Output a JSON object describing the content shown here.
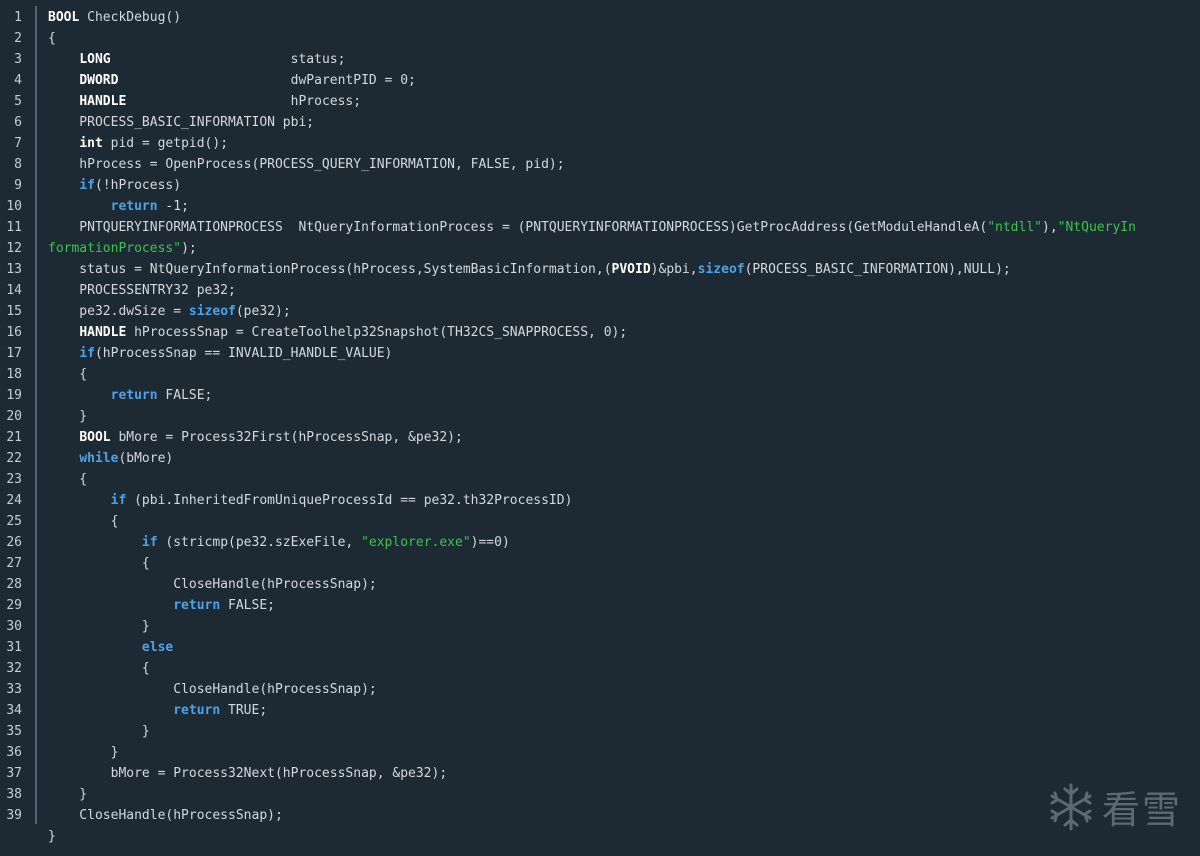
{
  "editor": {
    "language": "c",
    "token_colors": {
      "background": "#1e2a33",
      "plain": "#d2d8dd",
      "keyword": "#4aa3ea",
      "type": "#ffffff",
      "string": "#36c64b",
      "line_number": "#c6cdd2"
    },
    "lines": [
      {
        "n": "1",
        "tokens": [
          [
            "ty",
            "BOOL"
          ],
          [
            "p",
            " CheckDebug()"
          ]
        ]
      },
      {
        "n": "2",
        "tokens": [
          [
            "p",
            "{"
          ]
        ]
      },
      {
        "n": "3",
        "tokens": [
          [
            "p",
            "    "
          ],
          [
            "ty",
            "LONG"
          ],
          [
            "p",
            "                       status;"
          ]
        ]
      },
      {
        "n": "4",
        "tokens": [
          [
            "p",
            "    "
          ],
          [
            "ty",
            "DWORD"
          ],
          [
            "p",
            "                      dwParentPID = 0;"
          ]
        ]
      },
      {
        "n": "5",
        "tokens": [
          [
            "p",
            "    "
          ],
          [
            "ty",
            "HANDLE"
          ],
          [
            "p",
            "                     hProcess;"
          ]
        ]
      },
      {
        "n": "6",
        "tokens": [
          [
            "p",
            "    PROCESS_BASIC_INFORMATION pbi;"
          ]
        ]
      },
      {
        "n": "7",
        "tokens": [
          [
            "p",
            "    "
          ],
          [
            "ty",
            "int"
          ],
          [
            "p",
            " pid = getpid();"
          ]
        ]
      },
      {
        "n": "8",
        "tokens": [
          [
            "p",
            "    hProcess = OpenProcess(PROCESS_QUERY_INFORMATION, FALSE, pid);"
          ]
        ]
      },
      {
        "n": "9",
        "tokens": [
          [
            "p",
            "    "
          ],
          [
            "kw",
            "if"
          ],
          [
            "p",
            "(!hProcess)"
          ]
        ]
      },
      {
        "n": "10",
        "tokens": [
          [
            "p",
            "        "
          ],
          [
            "kw",
            "return"
          ],
          [
            "p",
            " -1;"
          ]
        ]
      },
      {
        "n": "11",
        "tokens": [
          [
            "p",
            "    PNTQUERYINFORMATIONPROCESS  NtQueryInformationProcess = (PNTQUERYINFORMATIONPROCESS)GetProcAddress(GetModuleHandleA("
          ],
          [
            "st",
            "\"ntdll\""
          ],
          [
            "p",
            ")"
          ],
          [
            "p",
            ","
          ],
          [
            "st",
            "\"NtQueryIn"
          ]
        ]
      },
      {
        "n": "12",
        "tokens": [
          [
            "st",
            "formationProcess\""
          ],
          [
            "p",
            ");"
          ]
        ]
      },
      {
        "n": "13",
        "tokens": [
          [
            "p",
            "    status = NtQueryInformationProcess(hProcess,SystemBasicInformation,("
          ],
          [
            "ty",
            "PVOID"
          ],
          [
            "p",
            ")&pbi,"
          ],
          [
            "kw",
            "sizeof"
          ],
          [
            "p",
            "(PROCESS_BASIC_INFORMATION),NULL);"
          ]
        ]
      },
      {
        "n": "14",
        "tokens": [
          [
            "p",
            "    PROCESSENTRY32 pe32;"
          ]
        ]
      },
      {
        "n": "15",
        "tokens": [
          [
            "p",
            "    pe32.dwSize = "
          ],
          [
            "kw",
            "sizeof"
          ],
          [
            "p",
            "(pe32);"
          ]
        ]
      },
      {
        "n": "16",
        "tokens": [
          [
            "p",
            "    "
          ],
          [
            "ty",
            "HANDLE"
          ],
          [
            "p",
            " hProcessSnap = CreateToolhelp32Snapshot(TH32CS_SNAPPROCESS, 0);"
          ]
        ]
      },
      {
        "n": "17",
        "tokens": [
          [
            "p",
            "    "
          ],
          [
            "kw",
            "if"
          ],
          [
            "p",
            "(hProcessSnap == INVALID_HANDLE_VALUE)"
          ]
        ]
      },
      {
        "n": "18",
        "tokens": [
          [
            "p",
            "    {"
          ]
        ]
      },
      {
        "n": "19",
        "tokens": [
          [
            "p",
            "        "
          ],
          [
            "kw",
            "return"
          ],
          [
            "p",
            " FALSE;"
          ]
        ]
      },
      {
        "n": "20",
        "tokens": [
          [
            "p",
            "    }"
          ]
        ]
      },
      {
        "n": "21",
        "tokens": [
          [
            "p",
            "    "
          ],
          [
            "ty",
            "BOOL"
          ],
          [
            "p",
            " bMore = Process32First(hProcessSnap, &pe32);"
          ]
        ]
      },
      {
        "n": "22",
        "tokens": [
          [
            "p",
            "    "
          ],
          [
            "kw",
            "while"
          ],
          [
            "p",
            "(bMore)"
          ]
        ]
      },
      {
        "n": "23",
        "tokens": [
          [
            "p",
            "    {"
          ]
        ]
      },
      {
        "n": "24",
        "tokens": [
          [
            "p",
            "        "
          ],
          [
            "kw",
            "if"
          ],
          [
            "p",
            " (pbi.InheritedFromUniqueProcessId == pe32.th32ProcessID)"
          ]
        ]
      },
      {
        "n": "25",
        "tokens": [
          [
            "p",
            "        {"
          ]
        ]
      },
      {
        "n": "26",
        "tokens": [
          [
            "p",
            "            "
          ],
          [
            "kw",
            "if"
          ],
          [
            "p",
            " (stricmp(pe32.szExeFile, "
          ],
          [
            "st",
            "\"explorer.exe\""
          ],
          [
            "p",
            ")==0)"
          ]
        ]
      },
      {
        "n": "27",
        "tokens": [
          [
            "p",
            "            {"
          ]
        ]
      },
      {
        "n": "28",
        "tokens": [
          [
            "p",
            "                CloseHandle(hProcessSnap);"
          ]
        ]
      },
      {
        "n": "29",
        "tokens": [
          [
            "p",
            "                "
          ],
          [
            "kw",
            "return"
          ],
          [
            "p",
            " FALSE;"
          ]
        ]
      },
      {
        "n": "30",
        "tokens": [
          [
            "p",
            "            }"
          ]
        ]
      },
      {
        "n": "31",
        "tokens": [
          [
            "p",
            "            "
          ],
          [
            "kw",
            "else"
          ]
        ]
      },
      {
        "n": "32",
        "tokens": [
          [
            "p",
            "            {"
          ]
        ]
      },
      {
        "n": "33",
        "tokens": [
          [
            "p",
            "                CloseHandle(hProcessSnap);"
          ]
        ]
      },
      {
        "n": "34",
        "tokens": [
          [
            "p",
            "                "
          ],
          [
            "kw",
            "return"
          ],
          [
            "p",
            " TRUE;"
          ]
        ]
      },
      {
        "n": "35",
        "tokens": [
          [
            "p",
            "            }"
          ]
        ]
      },
      {
        "n": "36",
        "tokens": [
          [
            "p",
            "        }"
          ]
        ]
      },
      {
        "n": "37",
        "tokens": [
          [
            "p",
            "        bMore = Process32Next(hProcessSnap, &pe32);"
          ]
        ]
      },
      {
        "n": "38",
        "tokens": [
          [
            "p",
            "    }"
          ]
        ]
      },
      {
        "n": "39",
        "tokens": [
          [
            "p",
            "    CloseHandle(hProcessSnap);"
          ]
        ]
      },
      {
        "n": "",
        "tokens": [
          [
            "p",
            "}"
          ]
        ]
      }
    ]
  },
  "watermark": {
    "icon": "snowflake-icon",
    "text": "看雪"
  }
}
